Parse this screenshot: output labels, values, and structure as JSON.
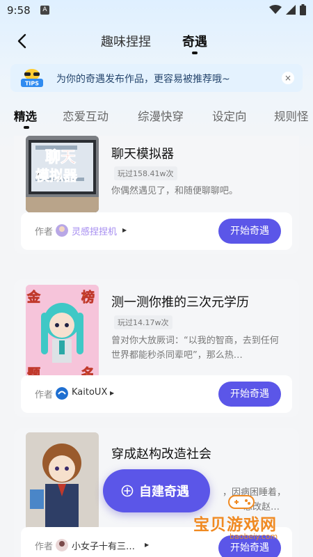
{
  "status": {
    "time": "9:58",
    "badge": "A"
  },
  "nav": {
    "tabs": [
      {
        "label": "趣味捏捏",
        "active": false
      },
      {
        "label": "奇遇",
        "active": true
      }
    ]
  },
  "tips": {
    "badge": "TIPS",
    "text": "为你的奇遇发布作品，更容易被推荐哦~",
    "close": "×"
  },
  "categories": [
    {
      "label": "精选",
      "active": true
    },
    {
      "label": "恋爱互动",
      "active": false
    },
    {
      "label": "综漫快穿",
      "active": false
    },
    {
      "label": "设定向",
      "active": false
    },
    {
      "label": "规则怪",
      "active": false
    }
  ],
  "cards": [
    {
      "title": "聊天模拟器",
      "plays": "玩过158.41w次",
      "desc": "你偶然遇见了，和随便聊聊吧。",
      "thumb_text": [
        "聊天",
        "模拟器"
      ],
      "author_label": "作者",
      "author": "灵感捏捏机",
      "author_color": "#a58cf0",
      "button": "开始奇遇"
    },
    {
      "title": "测一测你推的三次元学历",
      "plays": "玩过14.17w次",
      "desc": "曾对你大放厥词：“以我的智商，去到任何世界都能秒杀同辈吧”，那么热…",
      "thumb_text": [
        "金",
        "榜",
        "题",
        "名"
      ],
      "author_label": "作者",
      "author": "KaitoUX",
      "author_color": "#333333",
      "button": "开始奇遇"
    },
    {
      "title": "穿成赵构改造社会",
      "plays": "",
      "desc_visible": "，因病困睡着，",
      "desc_visible2": "想改赵…",
      "author_label": "作者",
      "author": "小女子十有三…",
      "author_color": "#333333",
      "button": "开始奇遇"
    }
  ],
  "fab": {
    "label": "自建奇遇"
  },
  "watermark": {
    "title": "宝贝游戏网",
    "url": "baobeiy.com"
  },
  "colors": {
    "accent": "#5b56e8",
    "tips_bg": "#e4f2fe",
    "watermark": "#f08a22"
  }
}
